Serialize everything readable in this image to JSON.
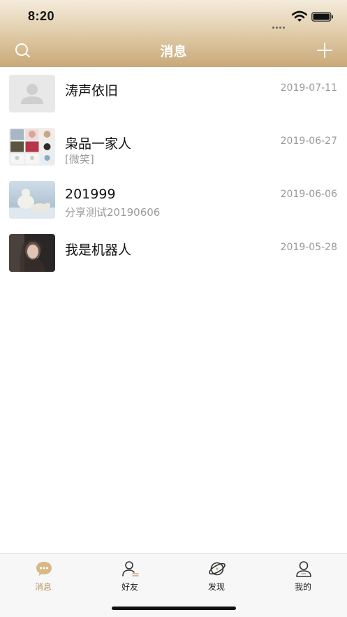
{
  "status_bar": {
    "time": "8:20"
  },
  "nav": {
    "title": "消息",
    "search_icon": "search-icon",
    "add_icon": "plus-icon"
  },
  "colors": {
    "accent": "#c9a877",
    "tab_active": "#b89460",
    "secondary_text": "#9a9a9a"
  },
  "conversations": [
    {
      "name": "涛声依旧",
      "preview": "",
      "date": "2019-07-11",
      "avatar": "default-person-avatar"
    },
    {
      "name": "枭品一家人",
      "preview": "[微笑]",
      "date": "2019-06-27",
      "avatar": "group-grid-avatar"
    },
    {
      "name": "201999",
      "preview": "分享测试20190606",
      "date": "2019-06-06",
      "avatar": "polar-bear-photo-avatar"
    },
    {
      "name": "我是机器人",
      "preview": "",
      "date": "2019-05-28",
      "avatar": "portrait-photo-avatar"
    }
  ],
  "tabs": [
    {
      "label": "消息",
      "icon": "chat-bubble-icon",
      "active": true
    },
    {
      "label": "好友",
      "icon": "friends-icon",
      "active": false
    },
    {
      "label": "发现",
      "icon": "planet-icon",
      "active": false
    },
    {
      "label": "我的",
      "icon": "profile-icon",
      "active": false
    }
  ]
}
